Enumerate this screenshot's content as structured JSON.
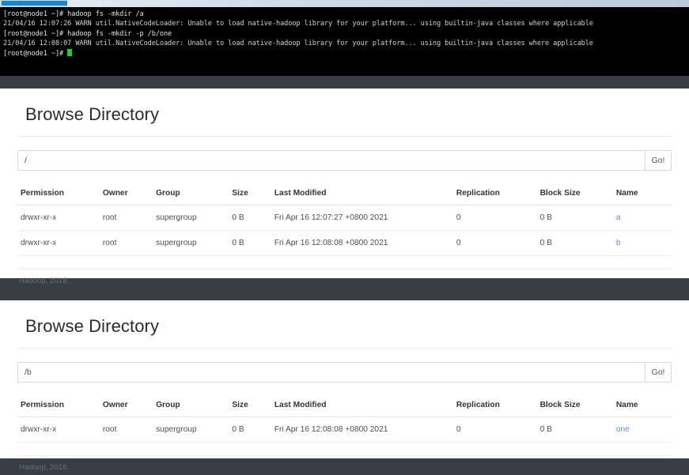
{
  "terminal": {
    "lines": [
      {
        "type": "cmd",
        "text": "[root@node1 ~]# hadoop fs -mkdir /a"
      },
      {
        "type": "warn",
        "text": "21/04/16 12:07:26 WARN util.NativeCodeLoader: Unable to load native-hadoop library for your platform... using builtin-java classes where applicable"
      },
      {
        "type": "cmd",
        "text": "[root@node1 ~]# hadoop fs -mkdir -p /b/one"
      },
      {
        "type": "warn",
        "text": "21/04/16 12:08:07 WARN util.NativeCodeLoader: Unable to load native-hadoop library for your platform... using builtin-java classes where applicable"
      },
      {
        "type": "prompt",
        "text": "[root@node1 ~]# "
      }
    ]
  },
  "colors": {
    "desktop_background": "#383e43",
    "terminal_background": "#000000",
    "terminal_text": "#d8d8d8",
    "cursor": "#19d419",
    "titlebar_accent": "#1a83d6",
    "link": "#5b8fd6"
  },
  "panels": [
    {
      "title": "Browse Directory",
      "path": {
        "value": "/",
        "placeholder": ""
      },
      "go_label": "Go!",
      "columns": [
        "Permission",
        "Owner",
        "Group",
        "Size",
        "Last Modified",
        "Replication",
        "Block Size",
        "Name"
      ],
      "rows": [
        {
          "permission": "drwxr-xr-x",
          "owner": "root",
          "group": "supergroup",
          "size": "0 B",
          "modified": "Fri Apr 16 12:07:27 +0800 2021",
          "replication": "0",
          "blocksize": "0 B",
          "name": "a"
        },
        {
          "permission": "drwxr-xr-x",
          "owner": "root",
          "group": "supergroup",
          "size": "0 B",
          "modified": "Fri Apr 16 12:08:08 +0800 2021",
          "replication": "0",
          "blocksize": "0 B",
          "name": "b"
        }
      ],
      "footer": "Hadoop, 2018."
    },
    {
      "title": "Browse Directory",
      "path": {
        "value": "/b",
        "placeholder": ""
      },
      "go_label": "Go!",
      "columns": [
        "Permission",
        "Owner",
        "Group",
        "Size",
        "Last Modified",
        "Replication",
        "Block Size",
        "Name"
      ],
      "rows": [
        {
          "permission": "drwxr-xr-x",
          "owner": "root",
          "group": "supergroup",
          "size": "0 B",
          "modified": "Fri Apr 16 12:08:08 +0800 2021",
          "replication": "0",
          "blocksize": "0 B",
          "name": "one"
        }
      ],
      "footer": "Hadoop, 2018."
    }
  ]
}
